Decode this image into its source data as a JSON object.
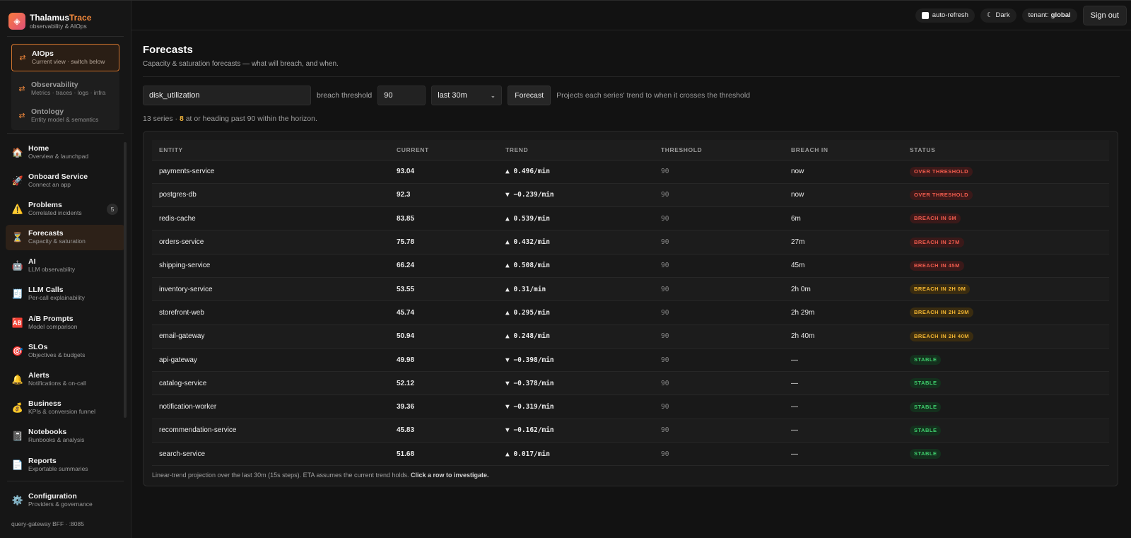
{
  "brand": {
    "name_main": "Thalamus",
    "name_accent": "Trace",
    "subtitle": "observability & AIOps"
  },
  "switcher": {
    "active": {
      "label": "AIOps",
      "sub": "Current view · switch below"
    },
    "options": [
      {
        "label": "Observability",
        "sub": "Metrics · traces · logs · infra"
      },
      {
        "label": "Ontology",
        "sub": "Entity model & semantics"
      }
    ]
  },
  "nav": [
    {
      "label": "Home",
      "sub": "Overview & launchpad",
      "icon": "house-icon",
      "glyph": "🏠"
    },
    {
      "label": "Onboard Service",
      "sub": "Connect an app",
      "icon": "rocket-icon",
      "glyph": "🚀"
    },
    {
      "label": "Problems",
      "sub": "Correlated incidents",
      "icon": "warning-icon",
      "glyph": "⚠️",
      "badge": "5"
    },
    {
      "label": "Forecasts",
      "sub": "Capacity & saturation",
      "icon": "hourglass-icon",
      "glyph": "⏳",
      "active": true
    },
    {
      "label": "AI",
      "sub": "LLM observability",
      "icon": "robot-icon",
      "glyph": "🤖"
    },
    {
      "label": "LLM Calls",
      "sub": "Per-call explainability",
      "icon": "receipt-icon",
      "glyph": "🧾"
    },
    {
      "label": "A/B Prompts",
      "sub": "Model comparison",
      "icon": "ab-icon",
      "glyph": "🆎"
    },
    {
      "label": "SLOs",
      "sub": "Objectives & budgets",
      "icon": "target-icon",
      "glyph": "🎯"
    },
    {
      "label": "Alerts",
      "sub": "Notifications & on-call",
      "icon": "bell-icon",
      "glyph": "🔔"
    },
    {
      "label": "Business",
      "sub": "KPIs & conversion funnel",
      "icon": "money-bag-icon",
      "glyph": "💰"
    },
    {
      "label": "Notebooks",
      "sub": "Runbooks & analysis",
      "icon": "notebook-icon",
      "glyph": "📓"
    },
    {
      "label": "Reports",
      "sub": "Exportable summaries",
      "icon": "document-icon",
      "glyph": "📄"
    }
  ],
  "config": {
    "label": "Configuration",
    "sub": "Providers & governance",
    "icon": "gear-icon",
    "glyph": "⚙️"
  },
  "footer": "query-gateway BFF · :8085",
  "topbar": {
    "auto_refresh": "auto-refresh",
    "theme": "Dark",
    "tenant_label": "tenant:",
    "tenant_value": "global",
    "sign_out": "Sign out"
  },
  "page": {
    "title": "Forecasts",
    "subtitle": "Capacity & saturation forecasts — what will breach, and when."
  },
  "controls": {
    "metric": "disk_utilization",
    "threshold_label": "breach threshold",
    "threshold": "90",
    "range": "last 30m",
    "button": "Forecast",
    "hint": "Projects each series' trend to when it crosses the threshold"
  },
  "summary": {
    "prefix": "13 series · ",
    "count": "8",
    "suffix": " at or heading past 90 within the horizon."
  },
  "table": {
    "columns": [
      "ENTITY",
      "CURRENT",
      "TREND",
      "THRESHOLD",
      "BREACH IN",
      "STATUS"
    ],
    "rows": [
      {
        "entity": "payments-service",
        "current": "93.04",
        "trend": "▲ 0.496/min",
        "threshold": "90",
        "breach": "now",
        "status": "OVER THRESHOLD",
        "level": "red"
      },
      {
        "entity": "postgres-db",
        "current": "92.3",
        "trend": "▼ −0.239/min",
        "threshold": "90",
        "breach": "now",
        "status": "OVER THRESHOLD",
        "level": "red"
      },
      {
        "entity": "redis-cache",
        "current": "83.85",
        "trend": "▲ 0.539/min",
        "threshold": "90",
        "breach": "6m",
        "status": "BREACH IN 6M",
        "level": "red"
      },
      {
        "entity": "orders-service",
        "current": "75.78",
        "trend": "▲ 0.432/min",
        "threshold": "90",
        "breach": "27m",
        "status": "BREACH IN 27M",
        "level": "red"
      },
      {
        "entity": "shipping-service",
        "current": "66.24",
        "trend": "▲ 0.508/min",
        "threshold": "90",
        "breach": "45m",
        "status": "BREACH IN 45M",
        "level": "red"
      },
      {
        "entity": "inventory-service",
        "current": "53.55",
        "trend": "▲ 0.31/min",
        "threshold": "90",
        "breach": "2h 0m",
        "status": "BREACH IN 2H 0M",
        "level": "yellow"
      },
      {
        "entity": "storefront-web",
        "current": "45.74",
        "trend": "▲ 0.295/min",
        "threshold": "90",
        "breach": "2h 29m",
        "status": "BREACH IN 2H 29M",
        "level": "yellow"
      },
      {
        "entity": "email-gateway",
        "current": "50.94",
        "trend": "▲ 0.248/min",
        "threshold": "90",
        "breach": "2h 40m",
        "status": "BREACH IN 2H 40M",
        "level": "yellow"
      },
      {
        "entity": "api-gateway",
        "current": "49.98",
        "trend": "▼ −0.398/min",
        "threshold": "90",
        "breach": "—",
        "status": "STABLE",
        "level": "green"
      },
      {
        "entity": "catalog-service",
        "current": "52.12",
        "trend": "▼ −0.378/min",
        "threshold": "90",
        "breach": "—",
        "status": "STABLE",
        "level": "green"
      },
      {
        "entity": "notification-worker",
        "current": "39.36",
        "trend": "▼ −0.319/min",
        "threshold": "90",
        "breach": "—",
        "status": "STABLE",
        "level": "green"
      },
      {
        "entity": "recommendation-service",
        "current": "45.83",
        "trend": "▼ −0.162/min",
        "threshold": "90",
        "breach": "—",
        "status": "STABLE",
        "level": "green"
      },
      {
        "entity": "search-service",
        "current": "51.68",
        "trend": "▲ 0.017/min",
        "threshold": "90",
        "breach": "—",
        "status": "STABLE",
        "level": "green"
      }
    ],
    "note": "Linear-trend projection over the last 30m (15s steps). ETA assumes the current trend holds. ",
    "note_bold": "Click a row to investigate."
  },
  "colors": {
    "accent": "#f58a3c",
    "danger": "#ef5b4d",
    "warning": "#f2b531",
    "ok": "#3ecb6b"
  }
}
